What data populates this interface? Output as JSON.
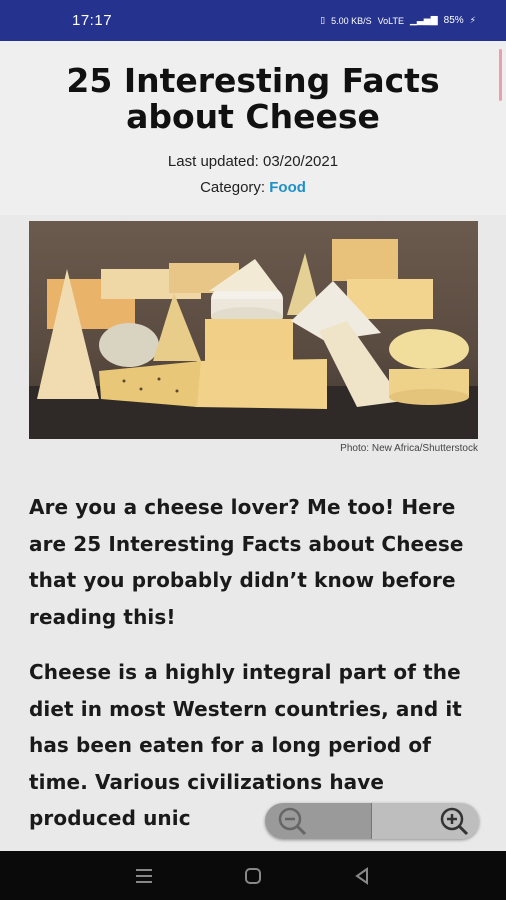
{
  "status_bar": {
    "time": "17:17",
    "network_text": "5.00 KB/S",
    "signal_text": "VoLTE",
    "battery": "85%"
  },
  "article": {
    "title": "25 Interesting Facts about Cheese",
    "last_updated_label": "Last updated: 03/20/2021",
    "category_label": "Category: ",
    "category_value": "Food",
    "photo_credit": "Photo: New Africa/Shutterstock",
    "paragraphs": [
      "Are you a cheese lover? Me too! Here are 25 Interesting Facts about Cheese that you probably didn’t know before reading this!",
      "Cheese is a highly integral part of the diet in most Western countries, and it has been eaten for a long period of time. Various civilizations have produced unic"
    ]
  },
  "colors": {
    "status_bar": "#25338f",
    "link": "#1e90c8",
    "page_bg": "#e9e9e9"
  },
  "icons": {
    "zoom_out": "zoom-out-icon",
    "zoom_in": "zoom-in-icon",
    "nav_menu": "menu-icon",
    "nav_home": "home-icon",
    "nav_back": "back-icon"
  }
}
